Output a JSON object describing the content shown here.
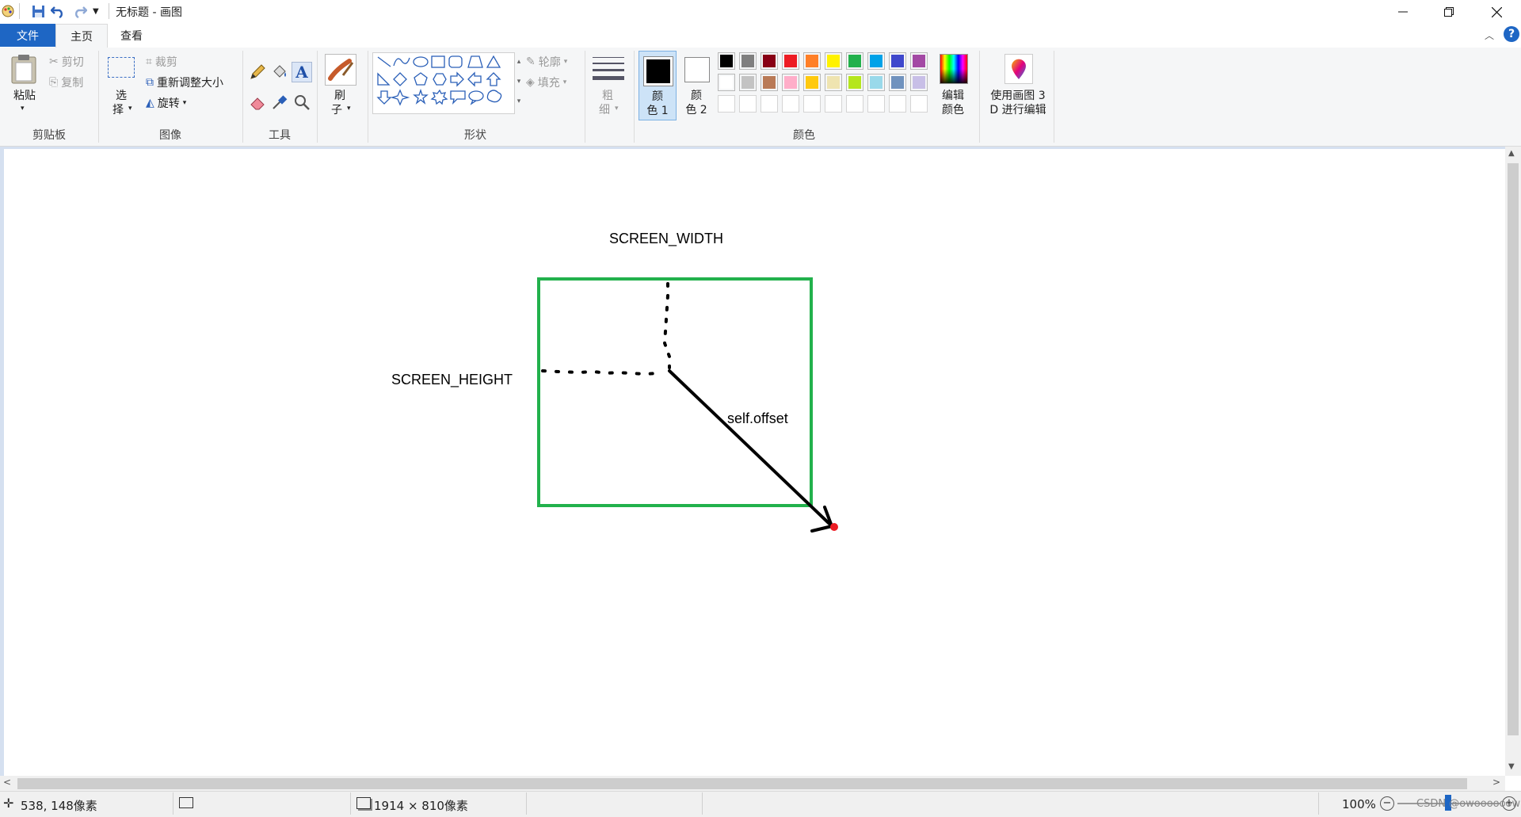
{
  "window": {
    "title": "无标题 - 画图",
    "minimize_icon": "minimize-icon",
    "restore_icon": "restore-icon",
    "close_icon": "close-icon"
  },
  "tabs": [
    {
      "label": "文件"
    },
    {
      "label": "主页"
    },
    {
      "label": "查看"
    }
  ],
  "ribbon": {
    "clipboard": {
      "paste": "粘贴",
      "cut": "剪切",
      "copy": "复制",
      "group_label": "剪贴板"
    },
    "image": {
      "select_1": "选",
      "select_2": "择",
      "crop": "裁剪",
      "resize": "重新调整大小",
      "rotate": "旋转",
      "group_label": "图像"
    },
    "tools": {
      "group_label": "工具",
      "brush_1": "刷",
      "brush_2": "子"
    },
    "shapes": {
      "outline": "轮廓",
      "fill": "填充",
      "group_label": "形状"
    },
    "size": {
      "label_1": "粗",
      "label_2": "细"
    },
    "colors": {
      "color1_1": "颜",
      "color1_2": "色 1",
      "color2_1": "颜",
      "color2_2": "色 2",
      "edit_1": "编辑",
      "edit_2": "颜色",
      "group_label": "颜色",
      "color1_value": "#000000",
      "color2_value": "#ffffff",
      "palette_row1": [
        "#000000",
        "#7f7f7f",
        "#880015",
        "#ed1c24",
        "#ff7f27",
        "#fff200",
        "#22b14c",
        "#00a2e8",
        "#3f48cc",
        "#a349a4"
      ],
      "palette_row2": [
        "#ffffff",
        "#c3c3c3",
        "#b97a57",
        "#ffaec9",
        "#ffc90e",
        "#efe4b0",
        "#b5e61d",
        "#99d9ea",
        "#7092be",
        "#c8bfe7"
      ]
    },
    "paint3d": {
      "label_1": "使用画图 3",
      "label_2": "D 进行编辑"
    }
  },
  "canvas": {
    "label_width": "SCREEN_WIDTH",
    "label_height": "SCREEN_HEIGHT",
    "label_offset": "self.offset",
    "rect_color": "#22b14c",
    "dot_color": "#ed1c24"
  },
  "status": {
    "cursor_pos": "538, 148像素",
    "canvas_size": "1914 × 810像素",
    "zoom": "100%",
    "watermark": "CSDN @owoooooow"
  }
}
